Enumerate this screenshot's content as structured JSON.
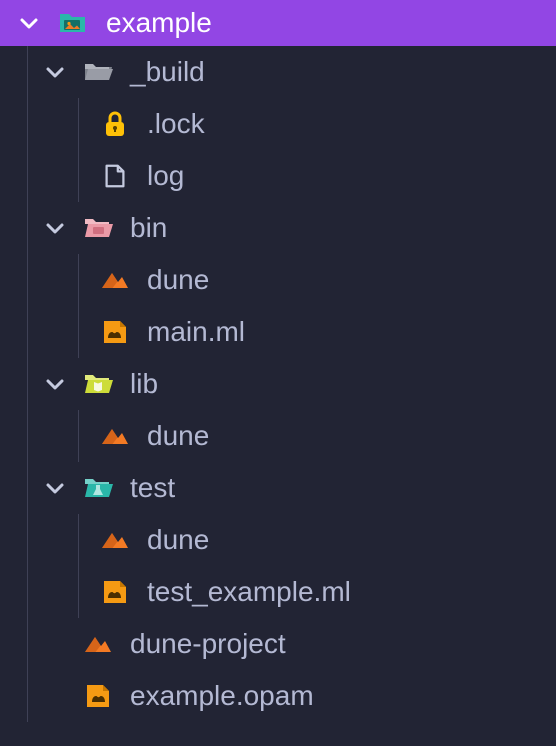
{
  "root": {
    "name": "example",
    "folder_icon": "root-image-folder-icon"
  },
  "folders": {
    "build": {
      "label": "_build"
    },
    "bin": {
      "label": "bin"
    },
    "lib": {
      "label": "lib"
    },
    "test": {
      "label": "test"
    }
  },
  "files": {
    "build_lock": {
      "label": ".lock"
    },
    "build_log": {
      "label": "log"
    },
    "bin_dune": {
      "label": "dune"
    },
    "bin_main": {
      "label": "main.ml"
    },
    "lib_dune": {
      "label": "dune"
    },
    "test_dune": {
      "label": "dune"
    },
    "test_example": {
      "label": "test_example.ml"
    },
    "dune_project": {
      "label": "dune-project"
    },
    "example_opam": {
      "label": "example.opam"
    }
  },
  "colors": {
    "chevron_header": "#ffffff",
    "chevron_body": "#c5cadf",
    "guide": "#3f4156",
    "text": "#b4b9d3",
    "header_bg": "#9246e4",
    "folder_gray": "#999ca6",
    "folder_pink": "#eb9aa7",
    "folder_lime": "#cddc39",
    "folder_teal": "#2ab7a9",
    "lock_yellow": "#ffc107",
    "file_gray": "#c5cadf",
    "dune_orange": "#f37a24",
    "ocaml_orange": "#f59a13",
    "root_teal": "#2ab7a9",
    "root_accent": "#f37a24"
  }
}
